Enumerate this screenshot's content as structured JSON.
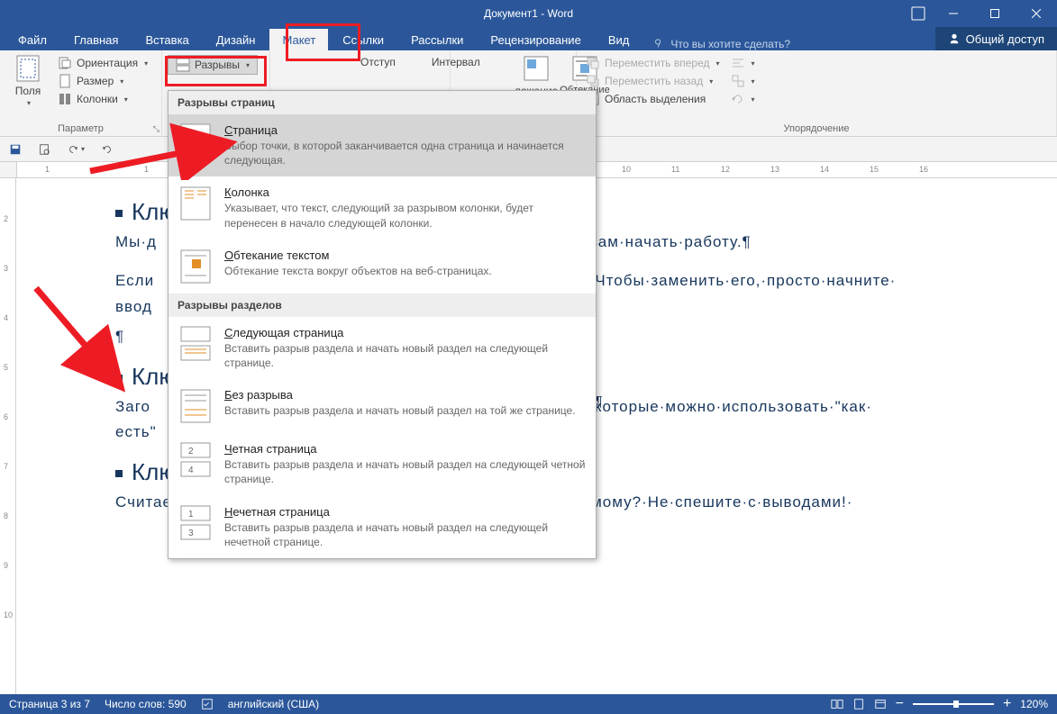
{
  "title": "Документ1 - Word",
  "tabs": {
    "file": "Файл",
    "home": "Главная",
    "insert": "Вставка",
    "design": "Дизайн",
    "layout": "Макет",
    "references": "Ссылки",
    "mailings": "Рассылки",
    "review": "Рецензирование",
    "view": "Вид"
  },
  "tell_me": "Что вы хотите сделать?",
  "share": "Общий доступ",
  "ribbon": {
    "margins": "Поля",
    "orientation": "Ориентация",
    "size": "Размер",
    "columns": "Колонки",
    "breaks": "Разрывы",
    "group_page_setup": "Параметр",
    "indent": "Отступ",
    "spacing": "Интервал",
    "position": "ложение",
    "wrap": "Обтекание текстом",
    "bring_forward": "Переместить вперед",
    "send_backward": "Переместить назад",
    "selection_pane": "Область выделения",
    "group_arrange": "Упорядочение"
  },
  "dropdown": {
    "section1": "Разрывы страниц",
    "page_title": "Страница",
    "page_desc": "Выбор точки, в которой заканчивается одна страница и начинается следующая.",
    "column_title": "Колонка",
    "column_desc": "Указывает, что текст, следующий за разрывом колонки, будет перенесен в начало следующей колонки.",
    "textwrap_title": "Обтекание текстом",
    "textwrap_desc": "Обтекание текста вокруг объектов на веб-страницах.",
    "section2": "Разрывы разделов",
    "nextpage_title": "Следующая страница",
    "nextpage_desc": "Вставить разрыв раздела и начать новый раздел на следующей странице.",
    "continuous_title": "Без разрыва",
    "continuous_desc": "Вставить разрыв раздела и начать новый раздел на той же странице.",
    "evenpage_title": "Четная страница",
    "evenpage_desc": "Вставить разрыв раздела и начать новый раздел на следующей четной странице.",
    "oddpage_title": "Нечетная страница",
    "oddpage_desc": "Вставить разрыв раздела и начать новый раздел на следующей нечетной странице."
  },
  "document": {
    "h1": "Клю",
    "p1a": "Мы·д",
    "p1b": "вам·начать·работу.¶",
    "p2a": "Если",
    "p2b": "т.·Чтобы·заменить·его,·просто·начните·",
    "p3": "ввод",
    "p4": "¶",
    "h2": "Клю",
    "p5a": "Заго",
    "p5b": "а,·которые·можно·использовать·\"как·",
    "p6": "есть\"",
    "h3": "Ключевые операционные аспекты¶",
    "p7": "Считаете,·что·такой·красивый·документ·сложно·создать·самому?·Не·спешите·с·выводами!·"
  },
  "status": {
    "page": "Страница 3 из 7",
    "words": "Число слов: 590",
    "language": "английский (США)",
    "zoom": "120%"
  },
  "ruler_h": [
    "1",
    "1",
    "10",
    "11",
    "12",
    "13",
    "14",
    "15",
    "16"
  ],
  "ruler_v": [
    "2",
    "3",
    "4",
    "5",
    "6",
    "7",
    "8",
    "9",
    "10"
  ]
}
